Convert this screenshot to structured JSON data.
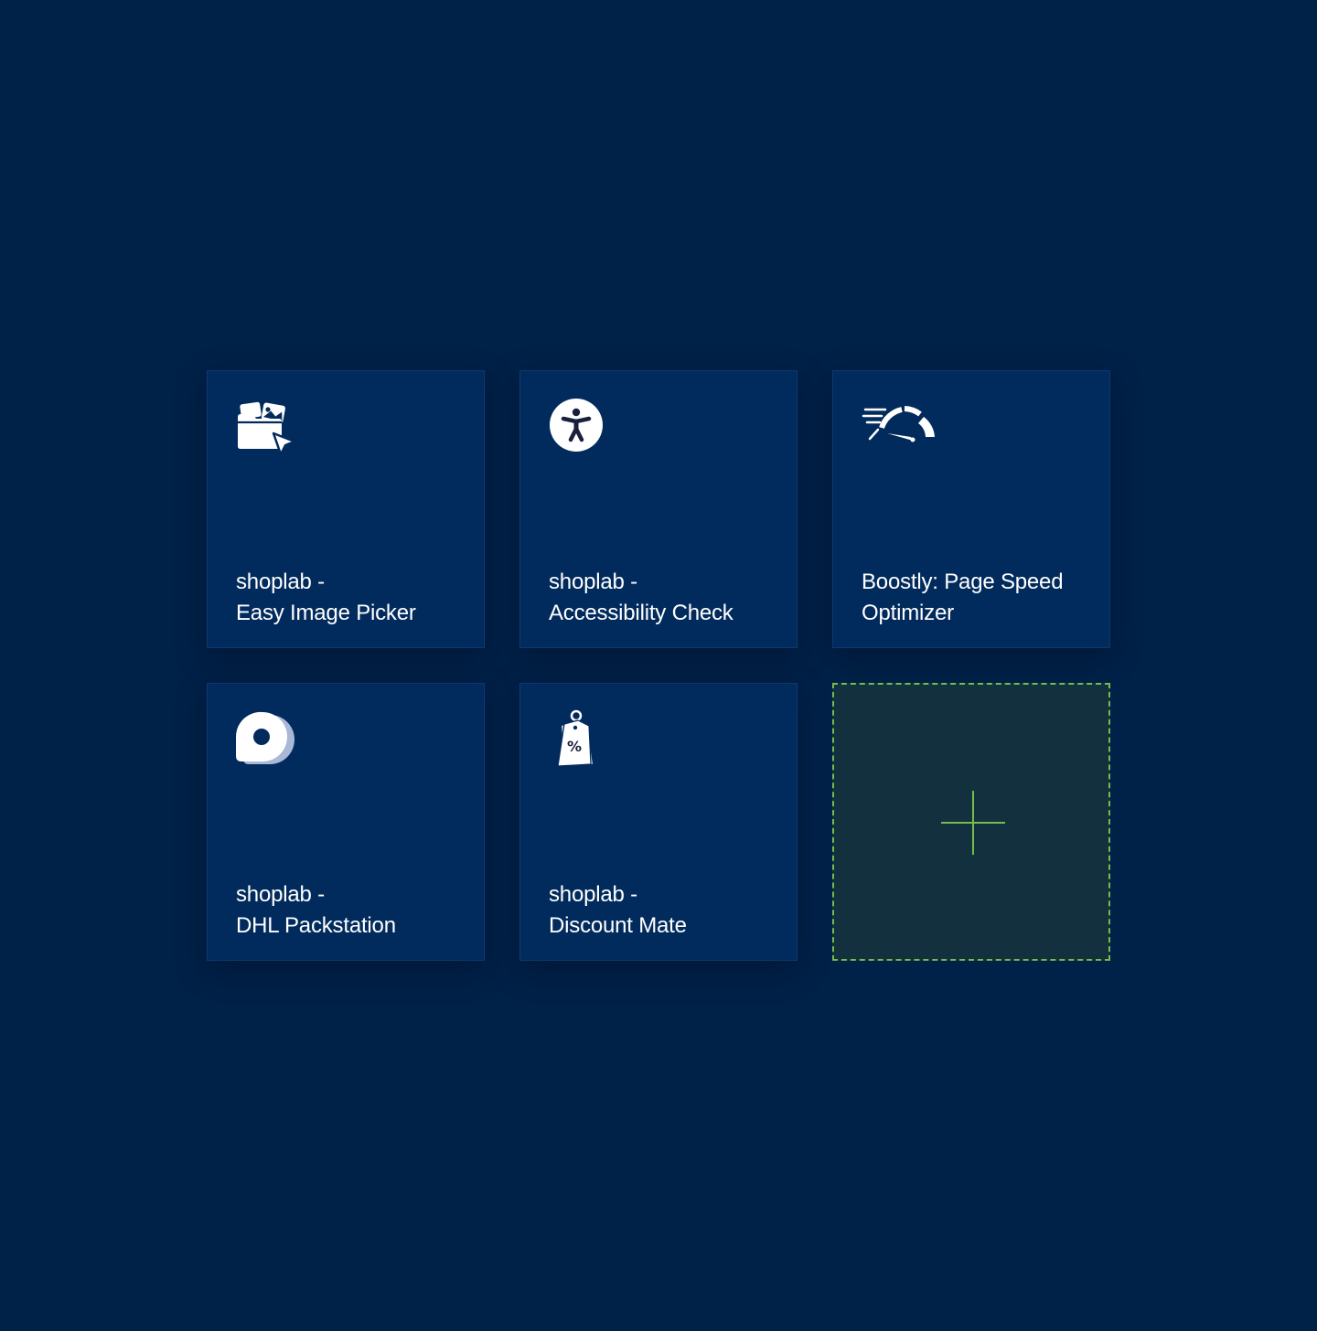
{
  "colors": {
    "background": "#002148",
    "tile": "#022b5d",
    "tile_border": "#0b3a70",
    "add_tile": "#12303d",
    "accent_green": "#74bd4a",
    "icon_white": "#ffffff"
  },
  "apps": [
    {
      "icon": "image-picker-icon",
      "title_line1": "shoplab -",
      "title_line2": "Easy Image Picker"
    },
    {
      "icon": "accessibility-icon",
      "title_line1": "shoplab -",
      "title_line2": "Accessibility Check"
    },
    {
      "icon": "speedometer-icon",
      "title_line1": "Boostly: Page Speed",
      "title_line2": "Optimizer"
    },
    {
      "icon": "packstation-icon",
      "title_line1": "shoplab -",
      "title_line2": "DHL Packstation"
    },
    {
      "icon": "discount-tag-icon",
      "title_line1": "shoplab -",
      "title_line2": "Discount Mate"
    }
  ],
  "add_tile": {
    "icon": "plus-icon"
  }
}
